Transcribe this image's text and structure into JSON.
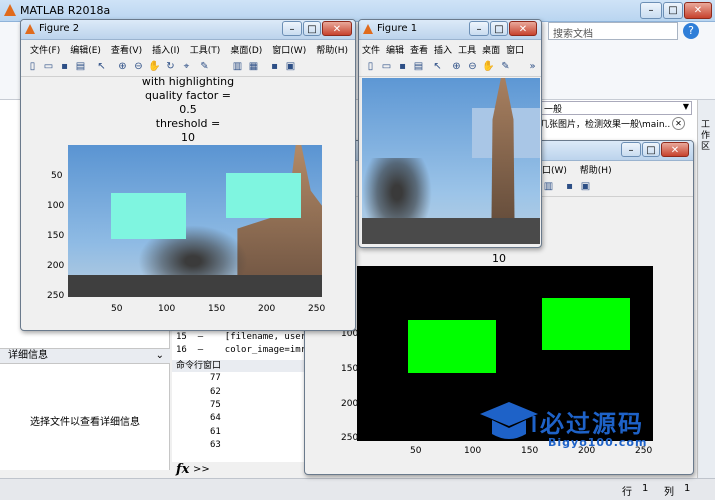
{
  "app": {
    "title": "MATLAB R2018a",
    "search_placeholder": "搜索文档",
    "help_icon": "question-icon",
    "side_tab": "工作区"
  },
  "left_panel": {
    "detail_header": "详细信息",
    "detail_text": "选择文件以查看详细信息",
    "chevron_icon": "chevron-down-icon"
  },
  "editor": {
    "dropdown_text": "一般",
    "hint_text": "几张图片，检测效果一般\\main...",
    "code_lines": [
      {
        "num": "15",
        "dash": "–",
        "code": "[filename, user_ca"
      },
      {
        "num": "16",
        "dash": "–",
        "code": "color_image=imread"
      }
    ]
  },
  "command_window": {
    "header": "命令行窗口",
    "values": [
      "77",
      "62",
      "75",
      "64",
      "61",
      "63"
    ],
    "prompt": ">>"
  },
  "status": {
    "row_label": "行",
    "row": "1",
    "col_label": "列",
    "col": "1"
  },
  "figure2": {
    "title": "Figure 2",
    "menu": [
      "文件(F)",
      "编辑(E)",
      "查看(V)",
      "插入(I)",
      "工具(T)",
      "桌面(D)",
      "窗口(W)",
      "帮助(H)"
    ],
    "plot_title_lines": [
      "with highlighting",
      "quality factor =",
      "0.5",
      "threshold =",
      "10"
    ],
    "x_ticks": [
      "50",
      "100",
      "150",
      "200",
      "250"
    ],
    "y_ticks": [
      "50",
      "100",
      "150",
      "200",
      "250"
    ]
  },
  "figure1": {
    "title": "Figure 1",
    "menu": [
      "文件",
      "编辑",
      "查看",
      "插入",
      "工具",
      "桌面",
      "窗口",
      "帮助"
    ]
  },
  "figure3": {
    "menu": [
      "口(W)",
      "帮助(H)"
    ],
    "plot_title": "10",
    "x_ticks": [
      "50",
      "100",
      "150",
      "200",
      "250"
    ],
    "y_ticks": [
      "100",
      "150",
      "200",
      "250"
    ]
  },
  "watermark": {
    "text": "必过源码",
    "sub": "Bigyo100.com"
  },
  "colors": {
    "mask": "#00ff00",
    "highlight": "#7ff5e0",
    "sky": "#6fa3d8"
  },
  "toolbar_icons": [
    "new-file-icon",
    "open-icon",
    "save-icon",
    "print-icon",
    "pointer-icon",
    "zoom-in-icon",
    "zoom-out-icon",
    "pan-icon",
    "rotate-icon",
    "data-cursor-icon",
    "brush-icon",
    "colorbar-icon",
    "legend-icon",
    "hide-plot-icon",
    "show-plot-icon"
  ]
}
